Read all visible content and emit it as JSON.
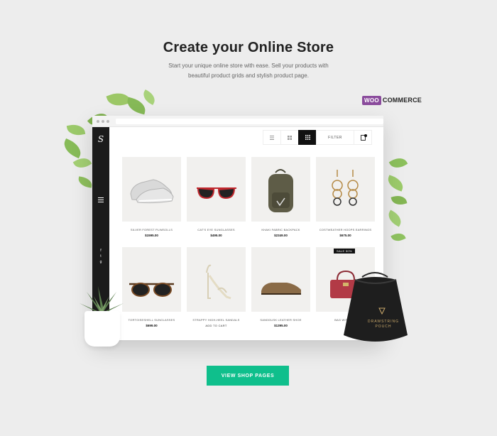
{
  "header": {
    "title": "Create your Online Store",
    "subtitle_line1": "Start your unique online store with ease. Sell your products with",
    "subtitle_line2": "beautiful product grids and stylish product page."
  },
  "woocommerce": {
    "badge": "WOO",
    "text": "COMMERCE",
    "color": "#8a4b9c"
  },
  "mockup": {
    "sidebar": {
      "logo": "S",
      "social": [
        "f",
        "t",
        "g"
      ]
    },
    "toolbar": {
      "views": [
        "list-view-icon",
        "grid-2-icon",
        "grid-4-icon"
      ],
      "active_view": 2,
      "filter_label": "FILTER"
    },
    "products": [
      {
        "name": "SILVER FOREST PLIMSOLLS",
        "price": "$1595.00",
        "image": "sneaker"
      },
      {
        "name": "CAT'S EYE SUNGLASSES",
        "price": "$495.00",
        "image": "red-sunglasses"
      },
      {
        "name": "KHAKI FABRIC BACKPACK",
        "price": "$2349.00",
        "image": "backpack"
      },
      {
        "name": "COSTWEATHER HOOPS EARRINGS",
        "price": "$675.00",
        "image": "earrings"
      },
      {
        "name": "TORTOISESHELL SUNGLASSES",
        "price": "$699.00",
        "image": "tortoise-sunglasses"
      },
      {
        "name": "STRAPPY HIGH-HEEL SANDALS",
        "price": "",
        "sub": "ADD TO CART",
        "image": "heels"
      },
      {
        "name": "SANDDUSK LEATHER SHOE",
        "price": "$1395.00",
        "image": "leather-shoe"
      },
      {
        "name": "BAG WITH STL",
        "price": "",
        "sale_badge": "SALE 50%",
        "image": "red-bag"
      }
    ]
  },
  "pouch_label_line1": "DRAWSTRING",
  "pouch_label_line2": "POUCH",
  "cta": {
    "label": "VIEW SHOP PAGES",
    "color": "#0fbf8c"
  }
}
